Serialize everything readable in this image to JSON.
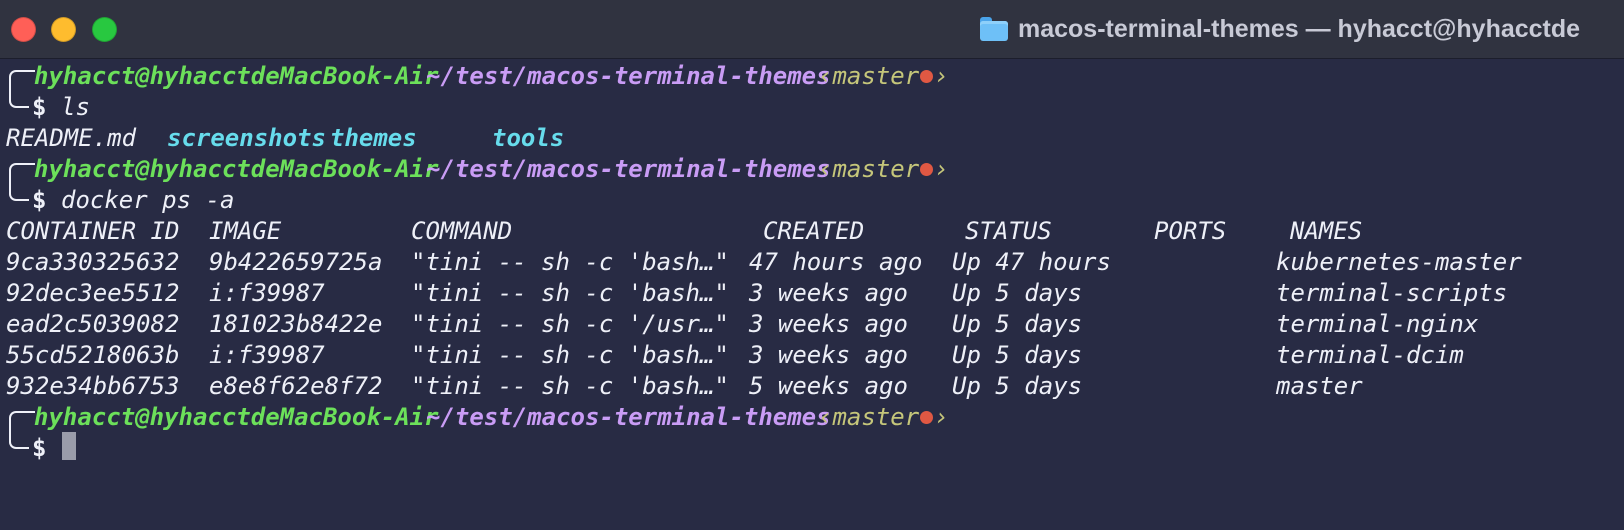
{
  "window": {
    "title": "macos-terminal-themes — hyhacct@hyhacctde",
    "controls": [
      "close-button",
      "minimize-button",
      "zoom-button"
    ]
  },
  "prompt": {
    "user_host": "hyhacct@hyhacctdeMacBook-Air",
    "path": "~/test/macos-terminal-themes",
    "git_open": "‹master",
    "git_close": "›",
    "git_dirty_color": "#e05843",
    "symbol": "$"
  },
  "colors": {
    "background": "#282b44",
    "user_host": "#6ce05a",
    "path": "#c99cf5",
    "git": "#c5c67a",
    "directory": "#67dcec",
    "text": "#eef0f8"
  },
  "commands": [
    "ls",
    "docker ps -a"
  ],
  "ls_output": [
    {
      "name": "README.md",
      "type": "file"
    },
    {
      "name": "screenshots",
      "type": "directory"
    },
    {
      "name": "themes",
      "type": "directory"
    },
    {
      "name": "tools",
      "type": "directory"
    }
  ],
  "docker": {
    "headers": [
      "CONTAINER ID",
      "IMAGE",
      "COMMAND",
      "CREATED",
      "STATUS",
      "PORTS",
      "NAMES"
    ],
    "rows": [
      [
        "9ca330325632",
        "9b422659725a",
        "\"tini -- sh -c 'bash…\"",
        "47 hours ago",
        "Up 47 hours",
        "",
        "kubernetes-master"
      ],
      [
        "92dec3ee5512",
        "i:f39987",
        "\"tini -- sh -c 'bash…\"",
        "3 weeks ago",
        "Up 5 days",
        "",
        "terminal-scripts"
      ],
      [
        "ead2c5039082",
        "181023b8422e",
        "\"tini -- sh -c '/usr…\"",
        "3 weeks ago",
        "Up 5 days",
        "",
        "terminal-nginx"
      ],
      [
        "55cd5218063b",
        "i:f39987",
        "\"tini -- sh -c 'bash…\"",
        "3 weeks ago",
        "Up 5 days",
        "",
        "terminal-dcim"
      ],
      [
        "932e34bb6753",
        "e8e8f62e8f72",
        "\"tini -- sh -c 'bash…\"",
        "5 weeks ago",
        "Up 5 days",
        "",
        "master"
      ]
    ]
  }
}
